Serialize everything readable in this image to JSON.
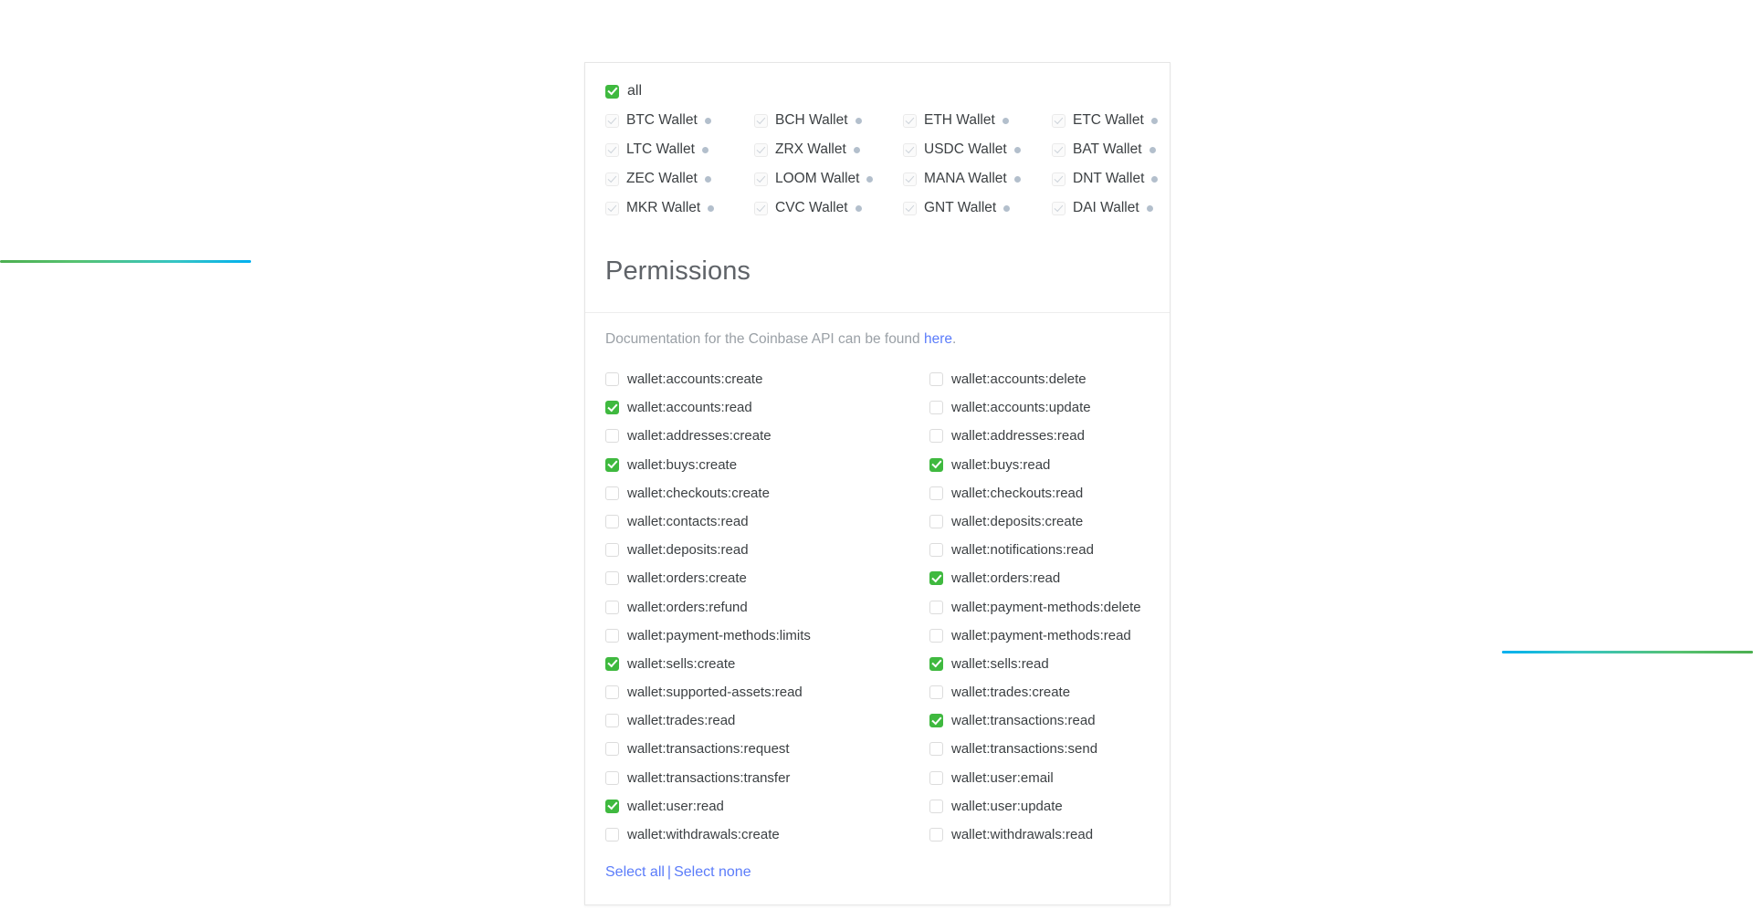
{
  "decor": {
    "left_line": "gradient-rule-green-to-blue",
    "right_line": "gradient-rule-blue-to-green",
    "accent_green": "#3fb93f",
    "accent_blue": "#5b7cfa",
    "gradient_green": "#4caf50",
    "gradient_cyan": "#00b0f0"
  },
  "wallets": {
    "all_label": "all",
    "all_checked": true,
    "items": [
      {
        "label": "BTC Wallet",
        "checked": true,
        "disabled": true,
        "dot": true
      },
      {
        "label": "BCH Wallet",
        "checked": true,
        "disabled": true,
        "dot": true
      },
      {
        "label": "ETH Wallet",
        "checked": true,
        "disabled": true,
        "dot": true
      },
      {
        "label": "ETC Wallet",
        "checked": true,
        "disabled": true,
        "dot": true
      },
      {
        "label": "LTC Wallet",
        "checked": true,
        "disabled": true,
        "dot": true
      },
      {
        "label": "ZRX Wallet",
        "checked": true,
        "disabled": true,
        "dot": true
      },
      {
        "label": "USDC Wallet",
        "checked": true,
        "disabled": true,
        "dot": true
      },
      {
        "label": "BAT Wallet",
        "checked": true,
        "disabled": true,
        "dot": true
      },
      {
        "label": "ZEC Wallet",
        "checked": true,
        "disabled": true,
        "dot": true
      },
      {
        "label": "LOOM Wallet",
        "checked": true,
        "disabled": true,
        "dot": true
      },
      {
        "label": "MANA Wallet",
        "checked": true,
        "disabled": true,
        "dot": true
      },
      {
        "label": "DNT Wallet",
        "checked": true,
        "disabled": true,
        "dot": true
      },
      {
        "label": "MKR Wallet",
        "checked": true,
        "disabled": true,
        "dot": true
      },
      {
        "label": "CVC Wallet",
        "checked": true,
        "disabled": true,
        "dot": true
      },
      {
        "label": "GNT Wallet",
        "checked": true,
        "disabled": true,
        "dot": true
      },
      {
        "label": "DAI Wallet",
        "checked": true,
        "disabled": true,
        "dot": true
      }
    ]
  },
  "permissions": {
    "title": "Permissions",
    "doc_prefix": "Documentation for the Coinbase API can be found ",
    "doc_link": "here",
    "doc_suffix": ".",
    "items": [
      {
        "label": "wallet:accounts:create",
        "checked": false
      },
      {
        "label": "wallet:accounts:delete",
        "checked": false
      },
      {
        "label": "wallet:accounts:read",
        "checked": true
      },
      {
        "label": "wallet:accounts:update",
        "checked": false
      },
      {
        "label": "wallet:addresses:create",
        "checked": false
      },
      {
        "label": "wallet:addresses:read",
        "checked": false
      },
      {
        "label": "wallet:buys:create",
        "checked": true
      },
      {
        "label": "wallet:buys:read",
        "checked": true
      },
      {
        "label": "wallet:checkouts:create",
        "checked": false
      },
      {
        "label": "wallet:checkouts:read",
        "checked": false
      },
      {
        "label": "wallet:contacts:read",
        "checked": false
      },
      {
        "label": "wallet:deposits:create",
        "checked": false
      },
      {
        "label": "wallet:deposits:read",
        "checked": false
      },
      {
        "label": "wallet:notifications:read",
        "checked": false
      },
      {
        "label": "wallet:orders:create",
        "checked": false
      },
      {
        "label": "wallet:orders:read",
        "checked": true
      },
      {
        "label": "wallet:orders:refund",
        "checked": false
      },
      {
        "label": "wallet:payment-methods:delete",
        "checked": false
      },
      {
        "label": "wallet:payment-methods:limits",
        "checked": false
      },
      {
        "label": "wallet:payment-methods:read",
        "checked": false
      },
      {
        "label": "wallet:sells:create",
        "checked": true
      },
      {
        "label": "wallet:sells:read",
        "checked": true
      },
      {
        "label": "wallet:supported-assets:read",
        "checked": false
      },
      {
        "label": "wallet:trades:create",
        "checked": false
      },
      {
        "label": "wallet:trades:read",
        "checked": false
      },
      {
        "label": "wallet:transactions:read",
        "checked": true
      },
      {
        "label": "wallet:transactions:request",
        "checked": false
      },
      {
        "label": "wallet:transactions:send",
        "checked": false
      },
      {
        "label": "wallet:transactions:transfer",
        "checked": false
      },
      {
        "label": "wallet:user:email",
        "checked": false
      },
      {
        "label": "wallet:user:read",
        "checked": true
      },
      {
        "label": "wallet:user:update",
        "checked": false
      },
      {
        "label": "wallet:withdrawals:create",
        "checked": false
      },
      {
        "label": "wallet:withdrawals:read",
        "checked": false
      }
    ],
    "select_all": "Select all",
    "separator": "|",
    "select_none": "Select none"
  }
}
